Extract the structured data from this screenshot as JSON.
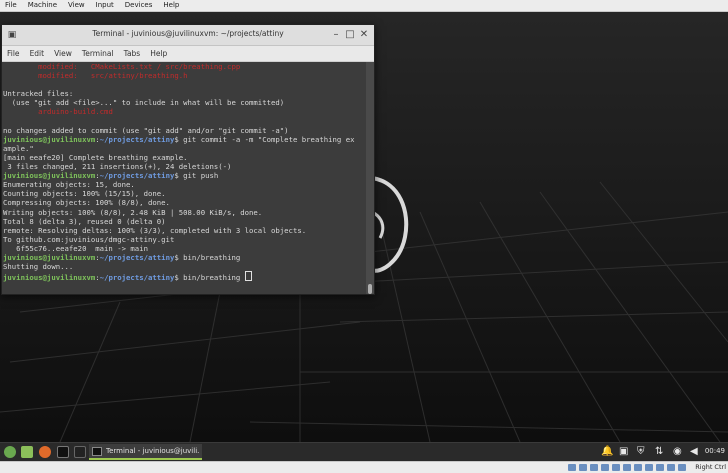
{
  "vbox": {
    "menu": [
      "File",
      "Machine",
      "View",
      "Input",
      "Devices",
      "Help"
    ],
    "host_key": "Right Ctrl"
  },
  "terminal": {
    "title": "Terminal - juvinious@juvilinuxvm: ~/projects/attiny",
    "menu": [
      "File",
      "Edit",
      "View",
      "Terminal",
      "Tabs",
      "Help"
    ],
    "lines": [
      {
        "parts": [
          {
            "t": "        modified:   ",
            "c": "red"
          },
          {
            "t": "CMakeLists.txt / src/breathing.cpp",
            "c": "red"
          }
        ]
      },
      {
        "parts": [
          {
            "t": "        modified:   ",
            "c": "red"
          },
          {
            "t": "src/attiny/breathing.h",
            "c": "red"
          }
        ]
      },
      {
        "parts": [
          {
            "t": "",
            "c": ""
          }
        ]
      },
      {
        "parts": [
          {
            "t": "Untracked files:",
            "c": ""
          }
        ]
      },
      {
        "parts": [
          {
            "t": "  (use \"git add <file>...\" to include in what will be committed)",
            "c": ""
          }
        ]
      },
      {
        "parts": [
          {
            "t": "        ",
            "c": ""
          },
          {
            "t": "arduino-build.cmd",
            "c": "red"
          }
        ]
      },
      {
        "parts": [
          {
            "t": "",
            "c": ""
          }
        ]
      },
      {
        "parts": [
          {
            "t": "no changes added to commit (use \"git add\" and/or \"git commit -a\")",
            "c": ""
          }
        ]
      },
      {
        "parts": [
          {
            "t": "juvinious@juvilinuxvm",
            "c": "prompt"
          },
          {
            "t": ":",
            "c": ""
          },
          {
            "t": "~/projects/attiny",
            "c": "path"
          },
          {
            "t": "$ git commit -a -m \"Complete breathing ex",
            "c": ""
          }
        ]
      },
      {
        "parts": [
          {
            "t": "ample.\"",
            "c": ""
          }
        ]
      },
      {
        "parts": [
          {
            "t": "[main eeafe20] Complete breathing example.",
            "c": ""
          }
        ]
      },
      {
        "parts": [
          {
            "t": " 3 files changed, 211 insertions(+), 24 deletions(-)",
            "c": ""
          }
        ]
      },
      {
        "parts": [
          {
            "t": "juvinious@juvilinuxvm",
            "c": "prompt"
          },
          {
            "t": ":",
            "c": ""
          },
          {
            "t": "~/projects/attiny",
            "c": "path"
          },
          {
            "t": "$ git push",
            "c": ""
          }
        ]
      },
      {
        "parts": [
          {
            "t": "Enumerating objects: 15, done.",
            "c": ""
          }
        ]
      },
      {
        "parts": [
          {
            "t": "Counting objects: 100% (15/15), done.",
            "c": ""
          }
        ]
      },
      {
        "parts": [
          {
            "t": "Compressing objects: 100% (8/8), done.",
            "c": ""
          }
        ]
      },
      {
        "parts": [
          {
            "t": "Writing objects: 100% (8/8), 2.48 KiB | 508.00 KiB/s, done.",
            "c": ""
          }
        ]
      },
      {
        "parts": [
          {
            "t": "Total 8 (delta 3), reused 0 (delta 0)",
            "c": ""
          }
        ]
      },
      {
        "parts": [
          {
            "t": "remote: Resolving deltas: 100% (3/3), completed with 3 local objects.",
            "c": ""
          }
        ]
      },
      {
        "parts": [
          {
            "t": "To github.com:juvinious/dmgc-attiny.git",
            "c": ""
          }
        ]
      },
      {
        "parts": [
          {
            "t": "   6f55c76..eeafe20  main -> main",
            "c": ""
          }
        ]
      },
      {
        "parts": [
          {
            "t": "juvinious@juvilinuxvm",
            "c": "prompt"
          },
          {
            "t": ":",
            "c": ""
          },
          {
            "t": "~/projects/attiny",
            "c": "path"
          },
          {
            "t": "$ bin/breathing",
            "c": ""
          }
        ]
      },
      {
        "parts": [
          {
            "t": "Shutting down...",
            "c": ""
          }
        ]
      },
      {
        "parts": [
          {
            "t": "juvinious@juvilinuxvm",
            "c": "prompt"
          },
          {
            "t": ":",
            "c": ""
          },
          {
            "t": "~/projects/attiny",
            "c": "path"
          },
          {
            "t": "$ bin/breathing ",
            "c": ""
          }
        ],
        "cursor": true
      }
    ]
  },
  "taskbar": {
    "task_label": "Terminal - juvinious@juvili...",
    "clock": "00:49",
    "tray_icons": [
      "notification-bell-icon",
      "clipboard-icon",
      "shield-icon",
      "network-icon",
      "update-icon",
      "volume-icon",
      "power-icon"
    ],
    "launcher_icons": [
      "menu-icon",
      "files-icon",
      "firefox-icon",
      "terminal-icon"
    ]
  },
  "colors": {
    "prompt": "#7ec25b",
    "path": "#6f9be0",
    "error": "#c32b2b",
    "accent": "#9ec84f"
  }
}
